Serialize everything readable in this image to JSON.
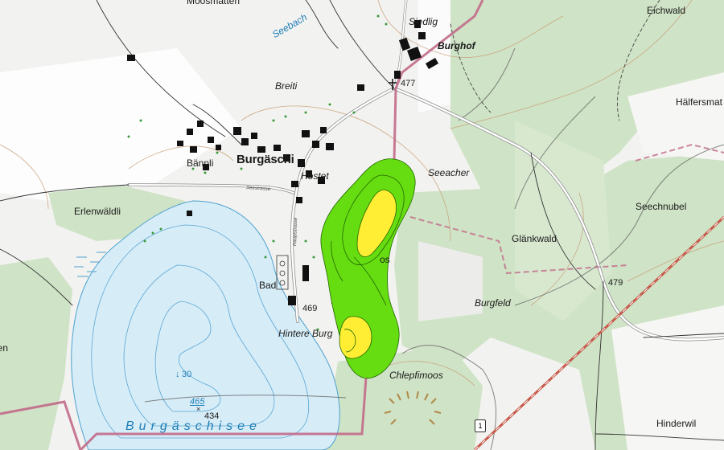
{
  "colors": {
    "background": "#f4f4f2",
    "forest": "#cfe3c6",
    "forest_dark": "#bcd9b2",
    "lake": "#d6ecf7",
    "contour_lake": "#5aa7d4",
    "contour_land": "#c9a27a",
    "border": "#c26a8a",
    "overlay_green": "#66dd11",
    "overlay_yellow": "#ffee33",
    "building": "#111111",
    "road_casing": "#888888"
  },
  "places": {
    "moosmatten": "Moosmatten",
    "eichwald": "Eichwald",
    "siedlig": "Siedlig",
    "burghof": "Burghof",
    "breiti": "Breiti",
    "haelfersmatt": "Hälfersmat",
    "baennli": "Bännli",
    "burgaeschi": "Burgäschi",
    "hostet": "Hostet",
    "seeacher": "Seeacher",
    "erlenwaeldli": "Erlenwäldli",
    "seechnubel": "Seechnubel",
    "glaenkwald": "Glänkwald",
    "bad": "Bad",
    "burgfeld": "Burgfeld",
    "hintere_burg": "Hintere Burg",
    "chlepfimoos": "Chlepfimoos",
    "hinderwil": "Hinderwil",
    "left_edge": "nen",
    "os_fragment": "os"
  },
  "water": {
    "seebach": "Seebach",
    "lake": "Burgäschisee"
  },
  "heights": {
    "h477": "477",
    "h479": "479",
    "h469": "469",
    "h434": "434"
  },
  "depths": {
    "d30": "30",
    "d465": "465"
  },
  "roads": {
    "hauptstrasse": "Hauptstrasse",
    "seestrasse": "Seestrasse",
    "route_number": "1"
  }
}
